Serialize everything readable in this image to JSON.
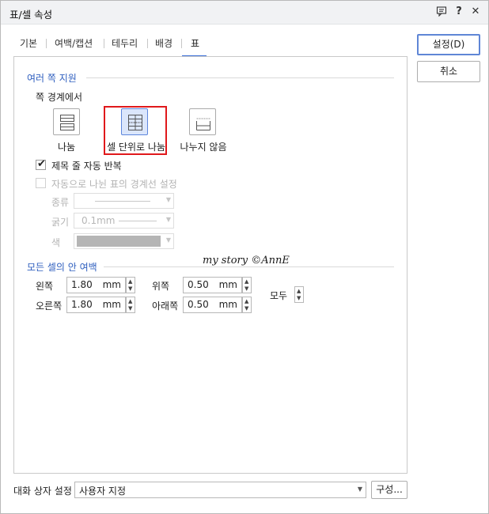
{
  "window": {
    "title": "표/셀 속성",
    "help_label": "?",
    "close_label": "✕"
  },
  "tabs": [
    {
      "label": "기본"
    },
    {
      "label": "여백/캡션"
    },
    {
      "label": "테두리"
    },
    {
      "label": "배경"
    },
    {
      "label": "표",
      "active": true
    }
  ],
  "split_section": {
    "title": "여러 쪽 지원",
    "subtitle": "쪽 경계에서",
    "options": [
      {
        "label": "나눔",
        "icon": "table-split-icon",
        "selected": false
      },
      {
        "label": "셀 단위로 나눔",
        "icon": "table-cell-split-icon",
        "selected": true
      },
      {
        "label": "나누지 않음",
        "icon": "table-no-split-icon",
        "selected": false
      }
    ],
    "repeat_header": {
      "label": "제목 줄 자동 반복",
      "checked": true
    },
    "auto_border": {
      "label": "자동으로 나뉜 표의 경계선 설정",
      "checked": false,
      "enabled": false
    },
    "kind_label": "종류",
    "thickness_label": "굵기",
    "thickness_value": "0.1mm",
    "color_label": "색",
    "color_value": "#b5b5b5"
  },
  "margin_section": {
    "title": "모든 셀의 안 여백",
    "left": {
      "label": "왼쪽",
      "value": "1.80",
      "unit": "mm"
    },
    "right": {
      "label": "오른쪽",
      "value": "1.80",
      "unit": "mm"
    },
    "top": {
      "label": "위쪽",
      "value": "0.50",
      "unit": "mm"
    },
    "bottom": {
      "label": "아래쪽",
      "value": "0.50",
      "unit": "mm"
    },
    "all_label": "모두"
  },
  "watermark": "my story ©AnnE",
  "buttons": {
    "ok": "설정(D)",
    "cancel": "취소"
  },
  "footer": {
    "dialog_setting_label": "대화 상자 설정",
    "dialog_setting_value": "사용자 지정",
    "config_button": "구성..."
  },
  "colors": {
    "accent": "#2f5fbf",
    "selected_bg": "#dbe6fb",
    "highlight_box": "#e0181b"
  }
}
